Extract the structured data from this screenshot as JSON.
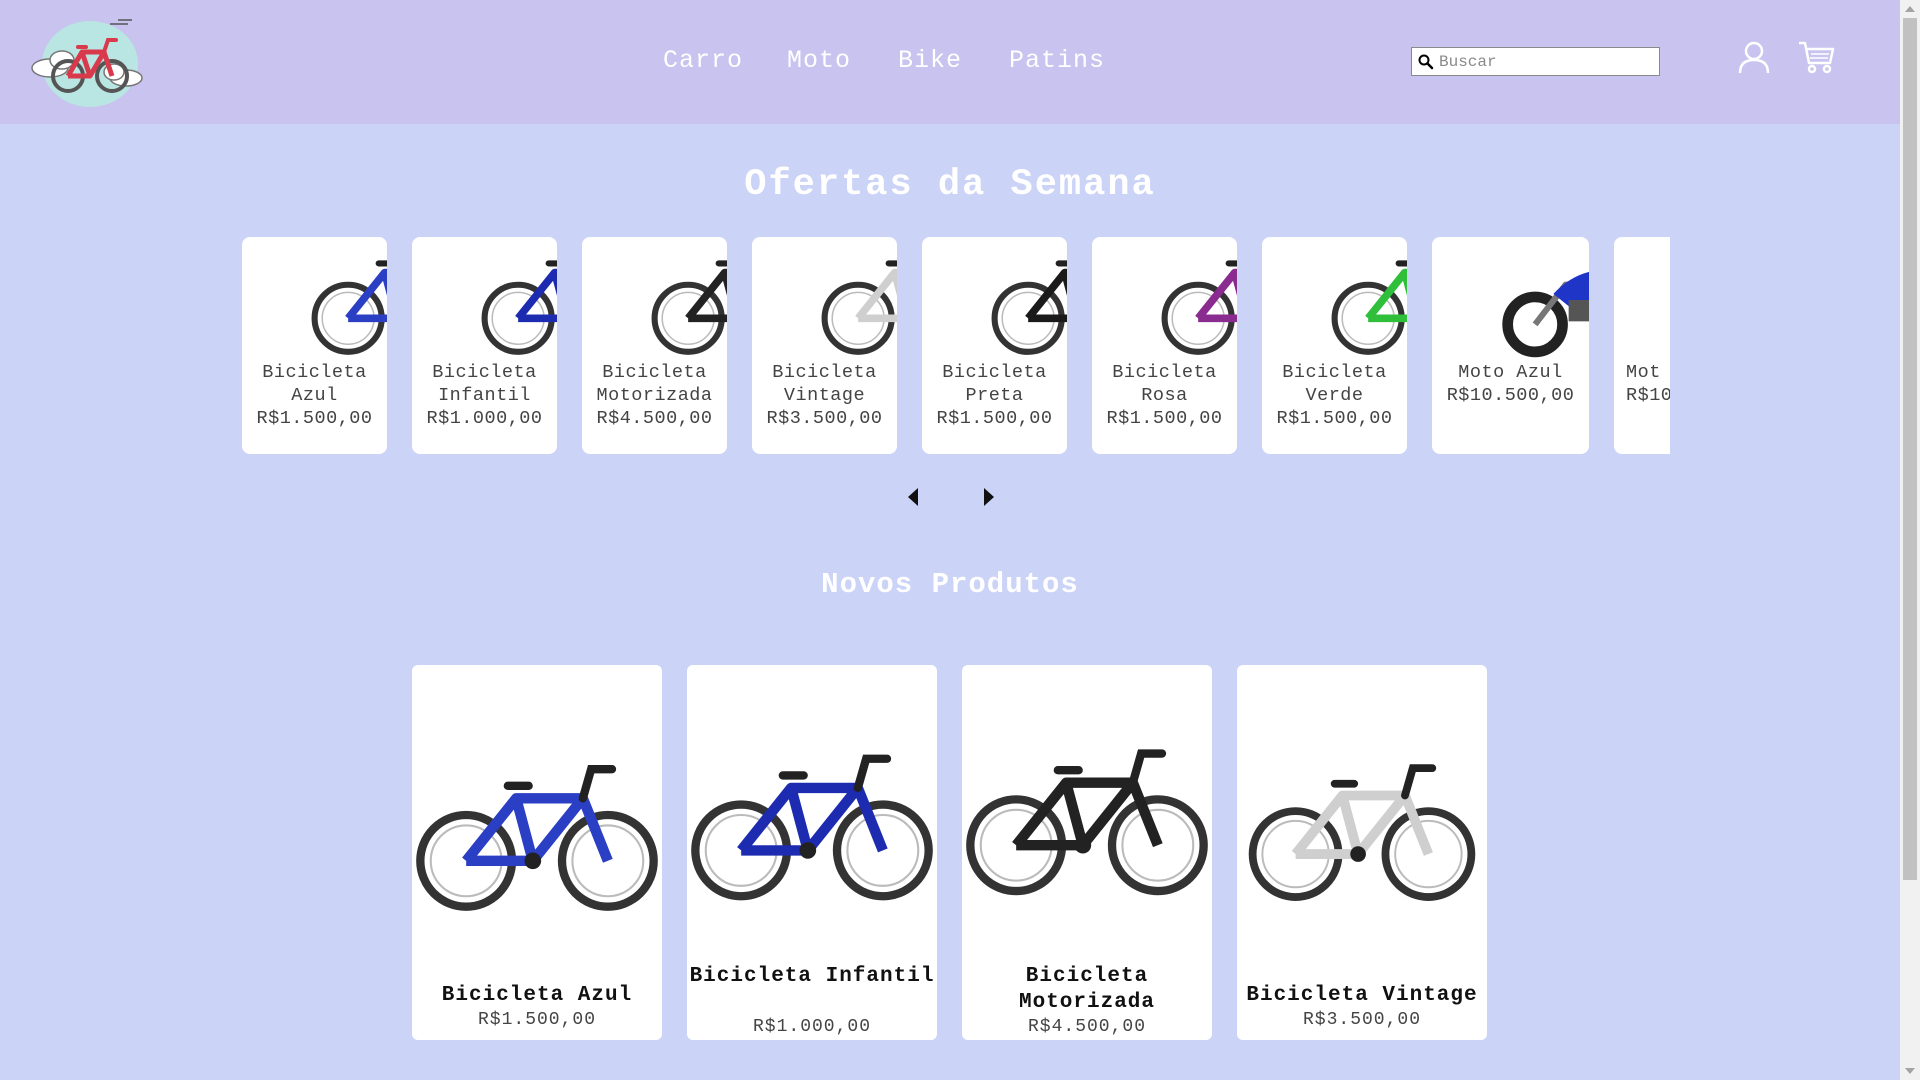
{
  "header": {
    "nav": [
      "Carro",
      "Moto",
      "Bike",
      "Patins"
    ],
    "search_placeholder": "Buscar"
  },
  "offers": {
    "title": "Ofertas da Semana",
    "items": [
      {
        "name": "Bicicleta Azul",
        "price": "R$1.500,00",
        "color": "#2a3fc4"
      },
      {
        "name": "Bicicleta Infantil",
        "price": "R$1.000,00",
        "color": "#1d2bb0"
      },
      {
        "name": "Bicicleta Motorizada",
        "price": "R$4.500,00",
        "color": "#222222"
      },
      {
        "name": "Bicicleta Vintage",
        "price": "R$3.500,00",
        "color": "#d8d8d8"
      },
      {
        "name": "Bicicleta Preta",
        "price": "R$1.500,00",
        "color": "#1a1a1a"
      },
      {
        "name": "Bicicleta Rosa",
        "price": "R$1.500,00",
        "color": "#8a2b8f"
      },
      {
        "name": "Bicicleta Verde",
        "price": "R$1.500,00",
        "color": "#2fbf3a"
      },
      {
        "name": "Moto Azul",
        "price": "R$10.500,00",
        "color": "#1f35c8"
      },
      {
        "name": "Mot",
        "price": "R$10",
        "color": "#333333"
      }
    ]
  },
  "new_products": {
    "title": "Novos Produtos",
    "items": [
      {
        "name": "Bicicleta Azul",
        "price": "R$1.500,00"
      },
      {
        "name": "Bicicleta Infantil",
        "price": "R$1.000,00"
      },
      {
        "name": "Bicicleta Motorizada",
        "price": "R$4.500,00"
      },
      {
        "name": "Bicicleta Vintage",
        "price": "R$3.500,00"
      }
    ]
  }
}
